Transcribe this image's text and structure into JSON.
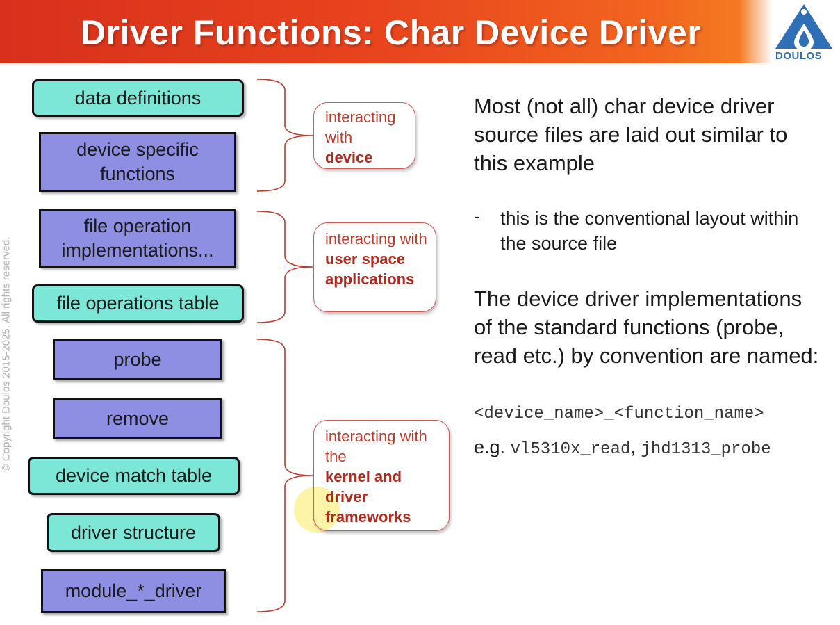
{
  "header": {
    "title": "Driver Functions: Char Device Driver",
    "logo_text": "DOULOS",
    "logo_icon": "doulos-logo-icon",
    "colors": {
      "title_gradient_start": "#d8301c",
      "title_gradient_end": "#f47a22",
      "logo_blue": "#2f6fb5"
    }
  },
  "side_note": "© Copyright Doulos 2015-2025. All rights reserved.",
  "boxes": [
    {
      "text": "data definitions",
      "style": "teal"
    },
    {
      "text": "device specific functions",
      "style": "purple"
    },
    {
      "text": "file operation implementations...",
      "style": "purple"
    },
    {
      "text": "file operations table",
      "style": "teal"
    },
    {
      "text": "probe",
      "style": "purple"
    },
    {
      "text": "remove",
      "style": "purple"
    },
    {
      "text": "device match table",
      "style": "teal"
    },
    {
      "text": "driver structure",
      "style": "teal"
    },
    {
      "text": "module_*_driver",
      "style": "purple"
    }
  ],
  "box_colors": {
    "teal": "#7ce7d7",
    "purple": "#8e8ee3"
  },
  "callouts": [
    {
      "plain": "interacting with",
      "bold": "device"
    },
    {
      "plain": "interacting with",
      "bold": "user space applications"
    },
    {
      "plain": "interacting with the",
      "bold": "kernel and driver frameworks"
    }
  ],
  "callout_color": "#c0392b",
  "content": {
    "intro": "Most (not all) char device driver source files are laid out similar to this example",
    "bullet_marker": "-",
    "bullet": "this is the conventional layout within the source file",
    "naming_para": "The device driver implementations of the standard functions (probe, read etc.) by convention are named:",
    "format": "<device_name>_<function_name>",
    "eg_label": "e.g.",
    "eg_example1": "vl5310x_read",
    "eg_separator": ",",
    "eg_example2": "jhd1313_probe"
  }
}
